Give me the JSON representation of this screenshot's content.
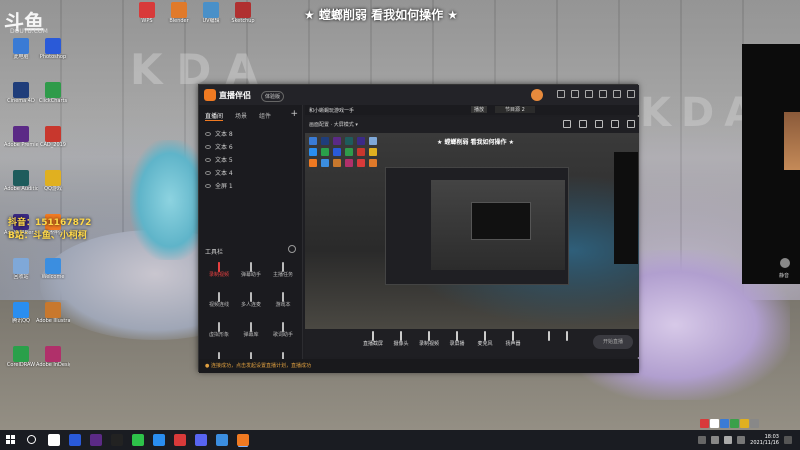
{
  "banner": {
    "text": "★ 螳螂削弱 看我如何操作 ★"
  },
  "watermark": {
    "logo": "斗鱼",
    "sub": "DOUYU.COM"
  },
  "overlay": {
    "douyin": "抖音：151167872",
    "bilibili": "B站：斗鱼、小柯柯"
  },
  "desktop_icons": [
    {
      "label": "此电脑",
      "color": "#3a7bd5"
    },
    {
      "label": "Cinema 4D",
      "color": "#1f3d7a"
    },
    {
      "label": "Adobe Premiere",
      "color": "#5b2a86"
    },
    {
      "label": "Adobe Audition",
      "color": "#1e5c5c"
    },
    {
      "label": "Adobe After Effects",
      "color": "#3b2a86"
    },
    {
      "label": "回收站",
      "color": "#7fa8d8"
    },
    {
      "label": "腾讯QQ",
      "color": "#2a8ef0"
    },
    {
      "label": "CorelDRAW",
      "color": "#2aa04a"
    },
    {
      "label": "Photoshop",
      "color": "#2a5ad8"
    },
    {
      "label": "ClickCharts",
      "color": "#2f9b4a"
    },
    {
      "label": "CAD_2019",
      "color": "#c8372d"
    },
    {
      "label": "QQ游戏",
      "color": "#e0b020"
    },
    {
      "label": "直播伴侣",
      "color": "#f07a22"
    },
    {
      "label": "Welcome",
      "color": "#3b8ee0"
    },
    {
      "label": "Adobe Illustrator",
      "color": "#c8782d"
    },
    {
      "label": "Adobe InDesign",
      "color": "#b0306a"
    },
    {
      "label": "WPS",
      "color": "#d83a3a"
    },
    {
      "label": "Blender",
      "color": "#e07a2a"
    },
    {
      "label": "UV编辑",
      "color": "#4a90c8"
    },
    {
      "label": "Sketchup",
      "color": "#b03030"
    }
  ],
  "app": {
    "title": "直播伴侣",
    "badge": "体验版",
    "tabs": [
      "直播间",
      "场景",
      "组件"
    ],
    "scenes": [
      "文本 8",
      "文本 6",
      "文本 5",
      "文本 4",
      "全屏 1"
    ],
    "tools_title": "工具栏",
    "tools": [
      "录制视频",
      "弹幕助手",
      "主播任务",
      "视频连线",
      "多人连麦",
      "游戏本",
      "虚拟形象",
      "弹幕库",
      "歌词助手",
      "更多",
      "",
      "",
      ""
    ],
    "crumb": "和小蜥蜴玩游戏一手",
    "crumb_tab": "播放",
    "crumb_tab2": "节目源 2",
    "toolbar_seg": "画面配置  · 大屏模式 ▾",
    "preview_banner": "★ 螳螂削弱 看我如何操作 ★",
    "bottom_items": [
      "直播截屏",
      "摄像头",
      "录制视频",
      "录屏播",
      "麦克风",
      "扬声器"
    ],
    "go_live": "开始直播",
    "status": "● 连接成功，点击发起设置直播计划，直播成功",
    "status2": ""
  },
  "right_panel": {
    "mic_label": "静音"
  },
  "ime": {
    "label": "S中"
  },
  "clock": {
    "time": "18:03",
    "date": "2021/11/16"
  },
  "taskbar_apps": [
    {
      "name": "task-view",
      "color": "#ffffff"
    },
    {
      "name": "photoshop",
      "color": "#2a5ad8"
    },
    {
      "name": "premiere",
      "color": "#5b2a86"
    },
    {
      "name": "capcut",
      "color": "#222222"
    },
    {
      "name": "wechat",
      "color": "#2ec24a"
    },
    {
      "name": "qq",
      "color": "#2a8ef0"
    },
    {
      "name": "music",
      "color": "#d83a3a"
    },
    {
      "name": "discord",
      "color": "#5865f2"
    },
    {
      "name": "shield",
      "color": "#3b8ee0"
    },
    {
      "name": "live-companion",
      "color": "#f07a22"
    }
  ]
}
